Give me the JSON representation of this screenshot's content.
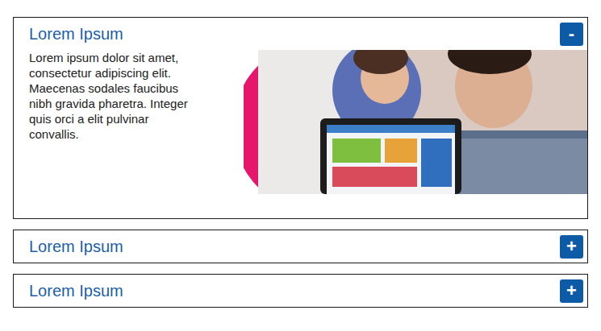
{
  "accordion": {
    "items": [
      {
        "title": "Lorem Ipsum",
        "expanded": true,
        "toggle": "-",
        "body": "Lorem ipsum dolor sit amet, consectetur adipiscing elit. Maecenas sodales faucibus nibh gravida pharetra. Integer quis orci a elit pulvinar convallis."
      },
      {
        "title": "Lorem Ipsum",
        "expanded": false,
        "toggle": "+"
      },
      {
        "title": "Lorem Ipsum",
        "expanded": false,
        "toggle": "+"
      }
    ]
  }
}
